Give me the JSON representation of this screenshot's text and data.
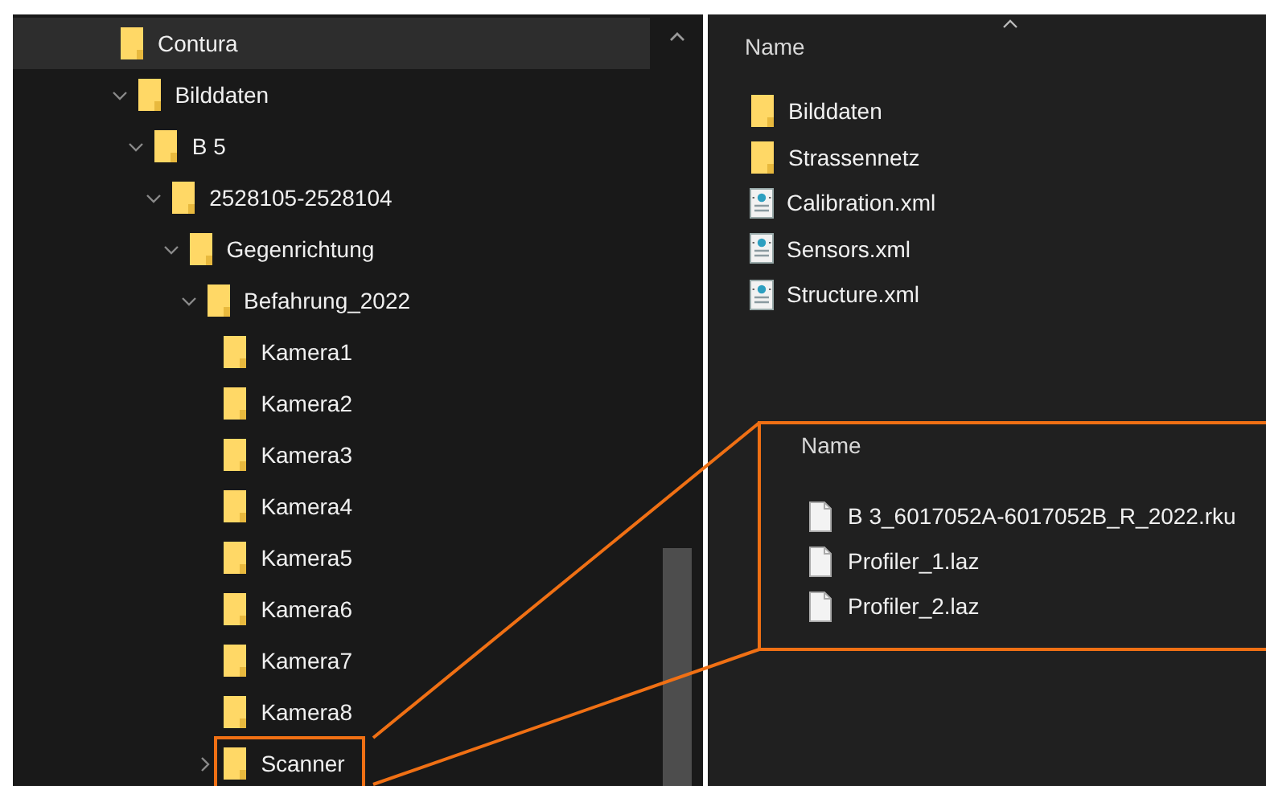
{
  "tree": [
    {
      "label": "Contura",
      "selected": true,
      "marked": false,
      "children": [
        {
          "label": "Bilddaten",
          "expanded": true,
          "selected": false,
          "marked": false,
          "children": [
            {
              "label": "B 5",
              "expanded": true,
              "selected": false,
              "marked": false,
              "children": [
                {
                  "label": "2528105-2528104",
                  "expanded": true,
                  "selected": false,
                  "marked": false,
                  "children": [
                    {
                      "label": "Gegenrichtung",
                      "expanded": true,
                      "selected": false,
                      "marked": false,
                      "children": [
                        {
                          "label": "Befahrung_2022",
                          "expanded": true,
                          "selected": false,
                          "marked": false,
                          "children": [
                            {
                              "label": "Kamera1",
                              "selected": false,
                              "marked": false
                            },
                            {
                              "label": "Kamera2",
                              "selected": false,
                              "marked": false
                            },
                            {
                              "label": "Kamera3",
                              "selected": false,
                              "marked": false
                            },
                            {
                              "label": "Kamera4",
                              "selected": false,
                              "marked": false
                            },
                            {
                              "label": "Kamera5",
                              "selected": false,
                              "marked": false
                            },
                            {
                              "label": "Kamera6",
                              "selected": false,
                              "marked": false
                            },
                            {
                              "label": "Kamera7",
                              "selected": false,
                              "marked": false
                            },
                            {
                              "label": "Kamera8",
                              "selected": false,
                              "marked": false
                            },
                            {
                              "label": "Scanner",
                              "expanded": false,
                              "selected": false,
                              "marked": true
                            }
                          ]
                        }
                      ]
                    }
                  ]
                }
              ]
            }
          ]
        }
      ]
    }
  ],
  "file_list": {
    "column": "Name",
    "items": [
      {
        "name": "Bilddaten",
        "kind": "folder"
      },
      {
        "name": "Strassennetz",
        "kind": "folder"
      },
      {
        "name": "Calibration.xml",
        "kind": "xml"
      },
      {
        "name": "Sensors.xml",
        "kind": "xml"
      },
      {
        "name": "Structure.xml",
        "kind": "xml"
      }
    ]
  },
  "callout": {
    "column": "Name",
    "items": [
      {
        "name": "B 3_6017052A-6017052B_R_2022.rku",
        "kind": "file"
      },
      {
        "name": "Profiler_1.laz",
        "kind": "file"
      },
      {
        "name": "Profiler_2.laz",
        "kind": "file"
      }
    ]
  }
}
